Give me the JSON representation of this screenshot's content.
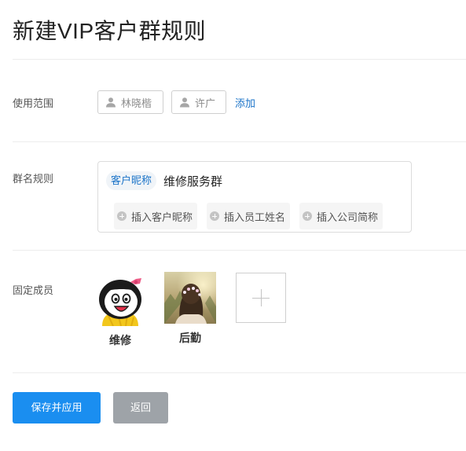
{
  "page": {
    "title": "新建VIP客户群规则"
  },
  "scope": {
    "label": "使用范围",
    "users": [
      "林晓楷",
      "许广"
    ],
    "add_link": "添加"
  },
  "name_rule": {
    "label": "群名规则",
    "variable_tag": "客户昵称",
    "text": "维修服务群",
    "insert_buttons": [
      "插入客户昵称",
      "插入员工姓名",
      "插入公司简称"
    ]
  },
  "fixed_members": {
    "label": "固定成员",
    "members": [
      {
        "name": "维修"
      },
      {
        "name": "后勤"
      }
    ]
  },
  "actions": {
    "save_label": "保存并应用",
    "back_label": "返回"
  },
  "colors": {
    "primary": "#1a8ef0",
    "link": "#1a73c8",
    "secondary_button": "#9ea3a8"
  }
}
